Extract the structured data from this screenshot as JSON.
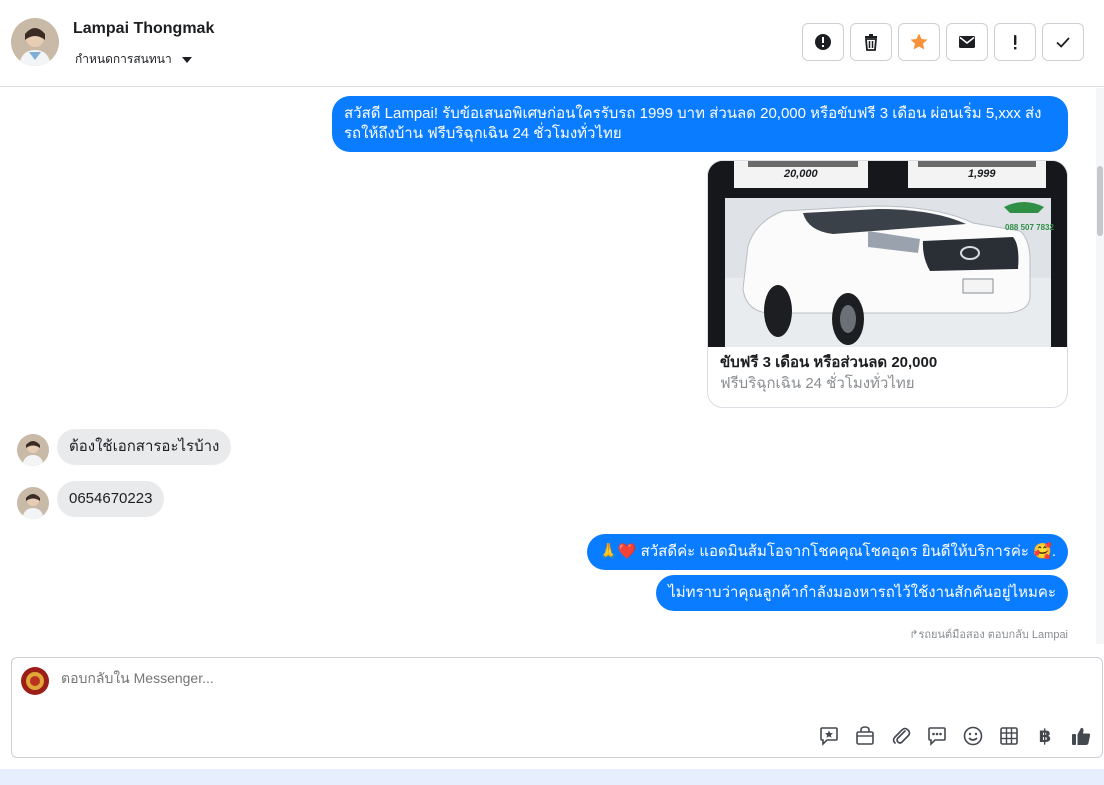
{
  "header": {
    "contact_name": "Lampai Thongmak",
    "assign_label": "กำหนดการสนทนา",
    "actions": [
      {
        "name": "report-spam",
        "icon": "alert-circle-icon"
      },
      {
        "name": "delete",
        "icon": "trash-icon"
      },
      {
        "name": "star",
        "icon": "star-icon",
        "color": "#f7923a"
      },
      {
        "name": "mark-unread",
        "icon": "envelope-icon"
      },
      {
        "name": "follow-up",
        "icon": "exclamation-icon"
      },
      {
        "name": "mark-done",
        "icon": "check-icon"
      }
    ]
  },
  "messages": {
    "out1": "สวัสดี Lampai! รับข้อเสนอพิเศษก่อนใครรับรถ 1999 บาท ส่วนลด 20,000 หรือขับฟรี 3 เดือน ผ่อนเริ่ม 5,xxx ส่งรถให้ถึงบ้าน ฟรีบริฉุกเฉิน 24 ชั่วโมงทั่วไทย",
    "card": {
      "title": "ขับฟรี 3 เดือน หรือส่วนลด 20,000",
      "subtitle": "ฟรีบริฉุกเฉิน 24 ชั่วโมงทั่วไทย",
      "price_tag_left": "20,000",
      "price_tag_right": "1,999",
      "watermark_phone": "088 507 7832"
    },
    "in1": "ต้องใช้เอกสารอะไรบ้าง",
    "in2": "0654670223",
    "out2": "🙏❤️ สวัสดีค่ะ แอดมินส้มโอจากโชคคุณโชคอุดร ยินดีให้บริการค่ะ 🥰.",
    "out3": "ไม่ทราบว่าคุณลูกค้ากำลังมองหารถไว้ใช้งานสักคันอยู่ไหมคะ",
    "reply_note": "รถยนต์มือสอง ตอบกลับ Lampai"
  },
  "composer": {
    "placeholder": "ตอบกลับใน Messenger...",
    "tools": [
      "sticker-icon",
      "shop-bag-icon",
      "attach-icon",
      "saved-reply-icon",
      "emoji-icon",
      "table-icon",
      "baht-icon",
      "like-icon"
    ],
    "baht_symbol": "฿"
  },
  "colors": {
    "accent": "#0a7cff",
    "incoming_bubble": "#e9eaec",
    "star": "#f7923a"
  }
}
